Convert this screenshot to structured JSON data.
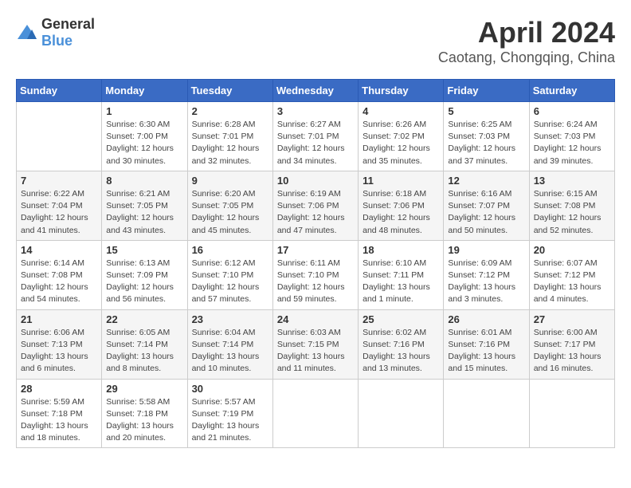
{
  "logo": {
    "general": "General",
    "blue": "Blue"
  },
  "title": "April 2024",
  "location": "Caotang, Chongqing, China",
  "headers": [
    "Sunday",
    "Monday",
    "Tuesday",
    "Wednesday",
    "Thursday",
    "Friday",
    "Saturday"
  ],
  "weeks": [
    [
      {
        "day": "",
        "info": ""
      },
      {
        "day": "1",
        "info": "Sunrise: 6:30 AM\nSunset: 7:00 PM\nDaylight: 12 hours\nand 30 minutes."
      },
      {
        "day": "2",
        "info": "Sunrise: 6:28 AM\nSunset: 7:01 PM\nDaylight: 12 hours\nand 32 minutes."
      },
      {
        "day": "3",
        "info": "Sunrise: 6:27 AM\nSunset: 7:01 PM\nDaylight: 12 hours\nand 34 minutes."
      },
      {
        "day": "4",
        "info": "Sunrise: 6:26 AM\nSunset: 7:02 PM\nDaylight: 12 hours\nand 35 minutes."
      },
      {
        "day": "5",
        "info": "Sunrise: 6:25 AM\nSunset: 7:03 PM\nDaylight: 12 hours\nand 37 minutes."
      },
      {
        "day": "6",
        "info": "Sunrise: 6:24 AM\nSunset: 7:03 PM\nDaylight: 12 hours\nand 39 minutes."
      }
    ],
    [
      {
        "day": "7",
        "info": "Sunrise: 6:22 AM\nSunset: 7:04 PM\nDaylight: 12 hours\nand 41 minutes."
      },
      {
        "day": "8",
        "info": "Sunrise: 6:21 AM\nSunset: 7:05 PM\nDaylight: 12 hours\nand 43 minutes."
      },
      {
        "day": "9",
        "info": "Sunrise: 6:20 AM\nSunset: 7:05 PM\nDaylight: 12 hours\nand 45 minutes."
      },
      {
        "day": "10",
        "info": "Sunrise: 6:19 AM\nSunset: 7:06 PM\nDaylight: 12 hours\nand 47 minutes."
      },
      {
        "day": "11",
        "info": "Sunrise: 6:18 AM\nSunset: 7:06 PM\nDaylight: 12 hours\nand 48 minutes."
      },
      {
        "day": "12",
        "info": "Sunrise: 6:16 AM\nSunset: 7:07 PM\nDaylight: 12 hours\nand 50 minutes."
      },
      {
        "day": "13",
        "info": "Sunrise: 6:15 AM\nSunset: 7:08 PM\nDaylight: 12 hours\nand 52 minutes."
      }
    ],
    [
      {
        "day": "14",
        "info": "Sunrise: 6:14 AM\nSunset: 7:08 PM\nDaylight: 12 hours\nand 54 minutes."
      },
      {
        "day": "15",
        "info": "Sunrise: 6:13 AM\nSunset: 7:09 PM\nDaylight: 12 hours\nand 56 minutes."
      },
      {
        "day": "16",
        "info": "Sunrise: 6:12 AM\nSunset: 7:10 PM\nDaylight: 12 hours\nand 57 minutes."
      },
      {
        "day": "17",
        "info": "Sunrise: 6:11 AM\nSunset: 7:10 PM\nDaylight: 12 hours\nand 59 minutes."
      },
      {
        "day": "18",
        "info": "Sunrise: 6:10 AM\nSunset: 7:11 PM\nDaylight: 13 hours\nand 1 minute."
      },
      {
        "day": "19",
        "info": "Sunrise: 6:09 AM\nSunset: 7:12 PM\nDaylight: 13 hours\nand 3 minutes."
      },
      {
        "day": "20",
        "info": "Sunrise: 6:07 AM\nSunset: 7:12 PM\nDaylight: 13 hours\nand 4 minutes."
      }
    ],
    [
      {
        "day": "21",
        "info": "Sunrise: 6:06 AM\nSunset: 7:13 PM\nDaylight: 13 hours\nand 6 minutes."
      },
      {
        "day": "22",
        "info": "Sunrise: 6:05 AM\nSunset: 7:14 PM\nDaylight: 13 hours\nand 8 minutes."
      },
      {
        "day": "23",
        "info": "Sunrise: 6:04 AM\nSunset: 7:14 PM\nDaylight: 13 hours\nand 10 minutes."
      },
      {
        "day": "24",
        "info": "Sunrise: 6:03 AM\nSunset: 7:15 PM\nDaylight: 13 hours\nand 11 minutes."
      },
      {
        "day": "25",
        "info": "Sunrise: 6:02 AM\nSunset: 7:16 PM\nDaylight: 13 hours\nand 13 minutes."
      },
      {
        "day": "26",
        "info": "Sunrise: 6:01 AM\nSunset: 7:16 PM\nDaylight: 13 hours\nand 15 minutes."
      },
      {
        "day": "27",
        "info": "Sunrise: 6:00 AM\nSunset: 7:17 PM\nDaylight: 13 hours\nand 16 minutes."
      }
    ],
    [
      {
        "day": "28",
        "info": "Sunrise: 5:59 AM\nSunset: 7:18 PM\nDaylight: 13 hours\nand 18 minutes."
      },
      {
        "day": "29",
        "info": "Sunrise: 5:58 AM\nSunset: 7:18 PM\nDaylight: 13 hours\nand 20 minutes."
      },
      {
        "day": "30",
        "info": "Sunrise: 5:57 AM\nSunset: 7:19 PM\nDaylight: 13 hours\nand 21 minutes."
      },
      {
        "day": "",
        "info": ""
      },
      {
        "day": "",
        "info": ""
      },
      {
        "day": "",
        "info": ""
      },
      {
        "day": "",
        "info": ""
      }
    ]
  ]
}
